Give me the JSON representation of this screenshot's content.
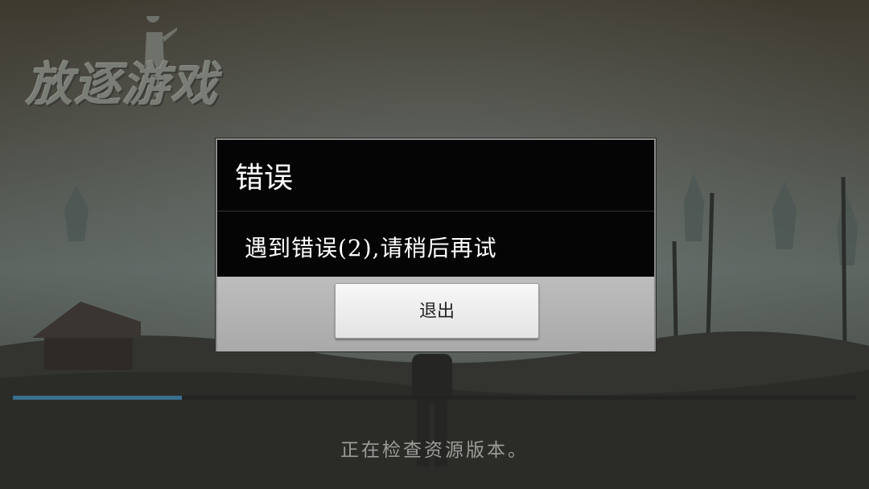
{
  "app": {
    "logo_text": "放逐游戏"
  },
  "dialog": {
    "title": "错误",
    "message": "遇到错误(2),请稍后再试",
    "exit_label": "退出"
  },
  "loading": {
    "progress": 0.2,
    "status": "正在检查资源版本。"
  },
  "colors": {
    "dialog_bg": "#050505",
    "dialog_footer": "#b3b3b3",
    "progress_fill": "#3a6f8f"
  }
}
